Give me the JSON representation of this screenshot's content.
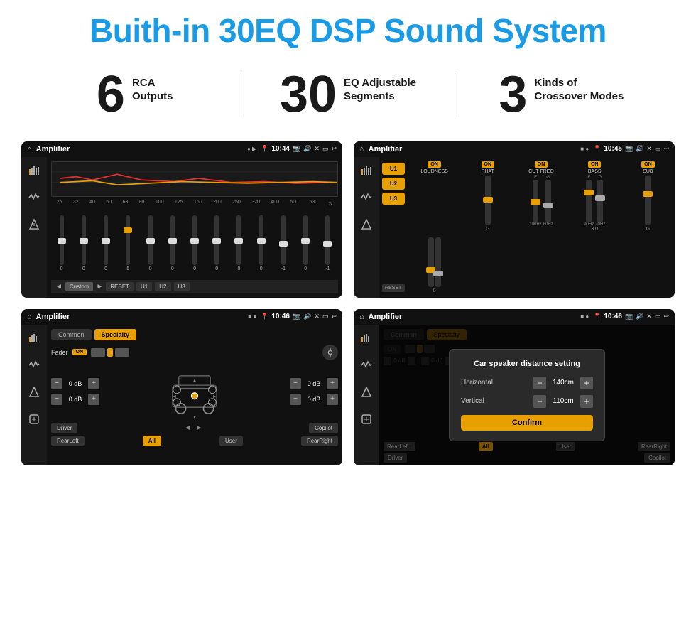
{
  "header": {
    "title": "Buith-in 30EQ DSP Sound System"
  },
  "stats": [
    {
      "number": "6",
      "line1": "RCA",
      "line2": "Outputs"
    },
    {
      "number": "30",
      "line1": "EQ Adjustable",
      "line2": "Segments"
    },
    {
      "number": "3",
      "line1": "Kinds of",
      "line2": "Crossover Modes"
    }
  ],
  "screenshots": {
    "eq": {
      "app_name": "Amplifier",
      "time": "10:44",
      "freq_labels": [
        "25",
        "32",
        "40",
        "50",
        "63",
        "80",
        "100",
        "125",
        "160",
        "200",
        "250",
        "320",
        "400",
        "500",
        "630"
      ],
      "slider_values": [
        "0",
        "0",
        "0",
        "5",
        "0",
        "0",
        "0",
        "0",
        "0",
        "0",
        "-1",
        "0",
        "-1"
      ],
      "bottom_buttons": [
        "Custom",
        "RESET",
        "U1",
        "U2",
        "U3"
      ]
    },
    "crossover": {
      "app_name": "Amplifier",
      "time": "10:45",
      "presets": [
        "U1",
        "U2",
        "U3"
      ],
      "channel_labels": [
        "LOUDNESS",
        "PHAT",
        "CUT FREQ",
        "BASS",
        "SUB"
      ],
      "reset_label": "RESET"
    },
    "fader": {
      "app_name": "Amplifier",
      "time": "10:46",
      "tabs": [
        "Common",
        "Specialty"
      ],
      "fader_label": "Fader",
      "db_values": [
        "0 dB",
        "0 dB",
        "0 dB",
        "0 dB"
      ],
      "buttons": [
        "Driver",
        "Copilot",
        "RearLeft",
        "All",
        "User",
        "RearRight"
      ]
    },
    "dialog": {
      "app_name": "Amplifier",
      "time": "10:46",
      "tabs": [
        "Common",
        "Specialty"
      ],
      "dialog_title": "Car speaker distance setting",
      "horizontal_label": "Horizontal",
      "horizontal_value": "140cm",
      "vertical_label": "Vertical",
      "vertical_value": "110cm",
      "confirm_label": "Confirm",
      "db_values": [
        "0 dB",
        "0 dB"
      ],
      "buttons": [
        "Driver",
        "Copilot",
        "RearLeft",
        "All",
        "User",
        "RearRight"
      ]
    }
  },
  "colors": {
    "accent": "#e8a000",
    "blue": "#1a9be6",
    "bg_dark": "#111111",
    "bg_darker": "#1a1a1a"
  }
}
